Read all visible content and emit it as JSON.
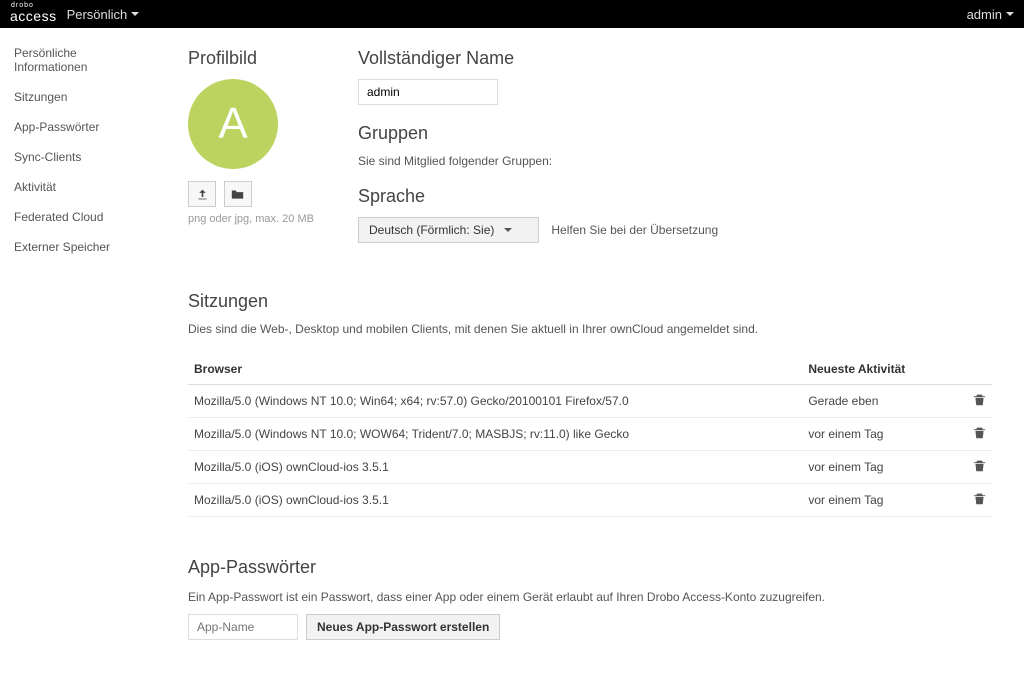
{
  "topbar": {
    "brand_top": "drobo",
    "brand_main": "access",
    "nav_label": "Persönlich",
    "user_label": "admin"
  },
  "sidebar": {
    "items": [
      "Persönliche Informationen",
      "Sitzungen",
      "App-Passwörter",
      "Sync-Clients",
      "Aktivität",
      "Federated Cloud",
      "Externer Speicher"
    ]
  },
  "profile": {
    "title": "Profilbild",
    "avatar_letter": "A",
    "upload_hint": "png oder jpg, max. 20 MB"
  },
  "fullname": {
    "title": "Vollständiger Name",
    "value": "admin"
  },
  "groups": {
    "title": "Gruppen",
    "text": "Sie sind Mitglied folgender Gruppen:"
  },
  "language": {
    "title": "Sprache",
    "selected": "Deutsch (Förmlich: Sie)",
    "help_link": "Helfen Sie bei der Übersetzung"
  },
  "sessions": {
    "title": "Sitzungen",
    "desc": "Dies sind die Web-, Desktop und mobilen Clients, mit denen Sie aktuell in Ihrer ownCloud angemeldet sind.",
    "col_browser": "Browser",
    "col_activity": "Neueste Aktivität",
    "rows": [
      {
        "browser": "Mozilla/5.0 (Windows NT 10.0; Win64; x64; rv:57.0) Gecko/20100101 Firefox/57.0",
        "activity": "Gerade eben"
      },
      {
        "browser": "Mozilla/5.0 (Windows NT 10.0; WOW64; Trident/7.0; MASBJS; rv:11.0) like Gecko",
        "activity": "vor einem Tag"
      },
      {
        "browser": "Mozilla/5.0 (iOS) ownCloud-ios 3.5.1",
        "activity": "vor einem Tag"
      },
      {
        "browser": "Mozilla/5.0 (iOS) ownCloud-ios 3.5.1",
        "activity": "vor einem Tag"
      }
    ]
  },
  "app_pw": {
    "title": "App-Passwörter",
    "desc": "Ein App-Passwort ist ein Passwort, dass einer App oder einem Gerät erlaubt auf Ihren Drobo Access-Konto zuzugreifen.",
    "placeholder": "App-Name",
    "button": "Neues App-Passwort erstellen"
  }
}
